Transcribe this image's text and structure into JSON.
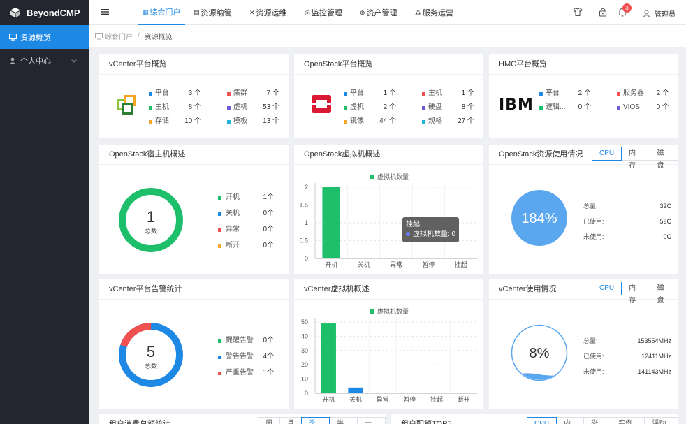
{
  "app": {
    "name": "BeyondCMP"
  },
  "sidebar": {
    "items": [
      {
        "label": "资源概览",
        "icon": "monitor-icon",
        "active": true
      },
      {
        "label": "个人中心",
        "icon": "user-icon",
        "active": false
      }
    ]
  },
  "topnav": {
    "tabs": [
      {
        "label": "综合门户",
        "icon": "grid-icon"
      },
      {
        "label": "资源纳管",
        "icon": "database-icon"
      },
      {
        "label": "资源运维",
        "icon": "tools-icon"
      },
      {
        "label": "监控管理",
        "icon": "monitor-icon"
      },
      {
        "label": "资产管理",
        "icon": "asset-icon"
      },
      {
        "label": "服务运营",
        "icon": "service-icon"
      }
    ],
    "notification_count": "3",
    "user": "管理员"
  },
  "breadcrumb": {
    "home": "综合门户",
    "separator": "/",
    "current": "资源概览"
  },
  "vcenter_overview": {
    "title": "vCenter平台概览",
    "stats": [
      {
        "label": "平台",
        "value": "3 个",
        "color": "#1e88e5"
      },
      {
        "label": "主机",
        "value": "8 个",
        "color": "#1dbf6a"
      },
      {
        "label": "存储",
        "value": "10 个",
        "color": "#f5a623"
      },
      {
        "label": "集群",
        "value": "7 个",
        "color": "#f05050"
      },
      {
        "label": "虚机",
        "value": "53 个",
        "color": "#6b5bd6"
      },
      {
        "label": "模板",
        "value": "13 个",
        "color": "#1fb5d6"
      }
    ]
  },
  "openstack_overview": {
    "title": "OpenStack平台概览",
    "stats": [
      {
        "label": "平台",
        "value": "1 个",
        "color": "#1e88e5"
      },
      {
        "label": "虚机",
        "value": "2 个",
        "color": "#1dbf6a"
      },
      {
        "label": "镜像",
        "value": "44 个",
        "color": "#f5a623"
      },
      {
        "label": "主机",
        "value": "1 个",
        "color": "#f05050"
      },
      {
        "label": "硬盘",
        "value": "8 个",
        "color": "#6b5bd6"
      },
      {
        "label": "规格",
        "value": "27 个",
        "color": "#1fb5d6"
      }
    ]
  },
  "hmc_overview": {
    "title": "HMC平台概览",
    "logo_text": "IBM",
    "stats": [
      {
        "label": "平台",
        "value": "2 个",
        "color": "#1e88e5"
      },
      {
        "label": "逻辑...",
        "value": "0 个",
        "color": "#1dbf6a"
      },
      {
        "label": "服务器",
        "value": "2 个",
        "color": "#f05050"
      },
      {
        "label": "VIOS",
        "value": "0 个",
        "color": "#6b5bd6"
      }
    ]
  },
  "os_host": {
    "title": "OpenStack宿主机概述",
    "total": "1",
    "total_label": "总数",
    "legend": [
      {
        "label": "开机",
        "value": "1个",
        "color": "#1dbf6a"
      },
      {
        "label": "关机",
        "value": "0个",
        "color": "#1e88e5"
      },
      {
        "label": "异常",
        "value": "0个",
        "color": "#f05050"
      },
      {
        "label": "断开",
        "value": "0个",
        "color": "#f5a623"
      }
    ]
  },
  "os_vm": {
    "title": "OpenStack虚拟机概述",
    "tooltip_title": "挂起",
    "tooltip_text": "虚拟机数量: 0"
  },
  "os_usage": {
    "title": "OpenStack资源使用情况",
    "tabs": [
      "CPU",
      "内存",
      "磁盘"
    ],
    "active_tab": "CPU",
    "percent_text": "184%",
    "percent": 184,
    "rows": [
      {
        "label": "总量:",
        "value": "32C"
      },
      {
        "label": "已使用:",
        "value": "59C"
      },
      {
        "label": "未使用:",
        "value": "0C"
      }
    ]
  },
  "vc_alarm": {
    "title": "vCenter平台告警统计",
    "total": "5",
    "total_label": "总数",
    "legend": [
      {
        "label": "提醒告警",
        "value": "0个",
        "color": "#1dbf6a"
      },
      {
        "label": "警告告警",
        "value": "4个",
        "color": "#1e88e5"
      },
      {
        "label": "严重告警",
        "value": "1个",
        "color": "#f05050"
      }
    ]
  },
  "vc_vm": {
    "title": "vCenter虚拟机概述"
  },
  "vc_usage": {
    "title": "vCenter使用情况",
    "tabs": [
      "CPU",
      "内存",
      "磁盘"
    ],
    "active_tab": "CPU",
    "percent_text": "8%",
    "percent": 8,
    "rows": [
      {
        "label": "总量:",
        "value": "153554MHz"
      },
      {
        "label": "已使用:",
        "value": "12411MHz"
      },
      {
        "label": "未使用:",
        "value": "141143MHz"
      }
    ]
  },
  "chart_data": [
    {
      "type": "bar",
      "title": "",
      "series": [
        {
          "name": "虚拟机数量",
          "values": [
            2,
            0,
            0,
            0,
            0
          ],
          "color": "#1dbf6a"
        }
      ],
      "categories": [
        "开机",
        "关机",
        "异常",
        "暂停",
        "挂起"
      ],
      "ylim": [
        0,
        2
      ],
      "yticks": [
        "0",
        "0.5",
        "1",
        "1.5",
        "2"
      ],
      "grid": true
    },
    {
      "type": "bar",
      "title": "",
      "series": [
        {
          "name": "虚拟机数量",
          "values": [
            49,
            4,
            0,
            0,
            0,
            0
          ],
          "colors": [
            "#1dbf6a",
            "#1e88e5",
            "#1dbf6a",
            "#1dbf6a",
            "#1dbf6a",
            "#1dbf6a"
          ]
        }
      ],
      "categories": [
        "开机",
        "关机",
        "异常",
        "暂停",
        "挂起",
        "断开"
      ],
      "ylim": [
        0,
        50
      ],
      "yticks": [
        "0",
        "10",
        "20",
        "30",
        "40",
        "50"
      ],
      "grid": true
    }
  ],
  "bottom": {
    "left_title": "租户消费总额统计",
    "left_tabs": [
      "周",
      "月",
      "季度",
      "半年",
      "一年"
    ],
    "left_active": "季度",
    "right_title": "租户配额TOP5",
    "right_tabs": [
      "CPU",
      "内存",
      "磁盘",
      "实例数",
      "浮动IP"
    ],
    "right_active": "CPU"
  }
}
